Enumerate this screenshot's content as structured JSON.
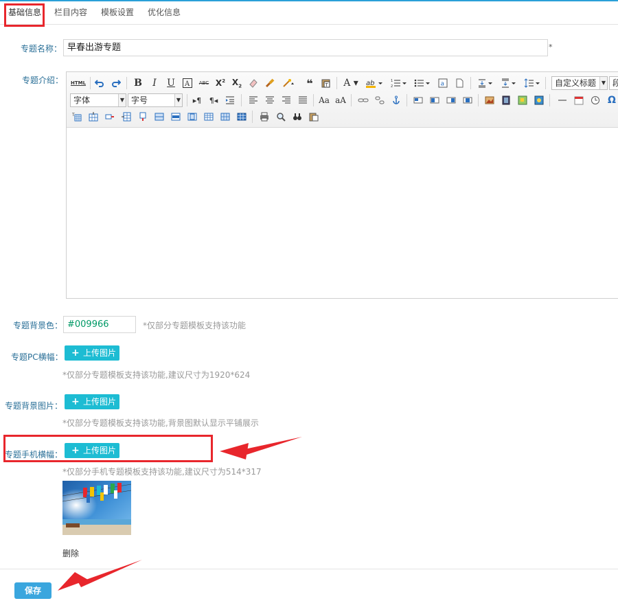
{
  "tabs": [
    {
      "label": "基础信息",
      "active": true
    },
    {
      "label": "栏目内容"
    },
    {
      "label": "模板设置"
    },
    {
      "label": "优化信息"
    }
  ],
  "form": {
    "name_label": "专题名称：",
    "name_value": "早春出游专题",
    "name_required": "*",
    "intro_label": "专题介绍：",
    "editor": {
      "font_select": "字体",
      "size_select": "字号",
      "heading_select": "自定义标题",
      "html_btn": "HTML",
      "bold": "B",
      "italic": "I",
      "underline": "U",
      "strike": "ABC"
    },
    "bgcolor_label": "专题背景色：",
    "bgcolor_value": "#009966",
    "bgcolor_hint": "*仅部分专题模板支持该功能",
    "pc_banner_label": "专题PC横幅：",
    "pc_banner_hint": "*仅部分专题模板支持该功能,建议尺寸为1920*624",
    "bg_image_label": "专题背景图片：",
    "bg_image_hint": "*仅部分专题模板支持该功能,背景图默认显示平铺展示",
    "mobile_banner_label": "专题手机横幅：",
    "mobile_banner_hint": "*仅部分手机专题模板支持该功能,建议尺寸为514*317",
    "upload_label": "上传图片",
    "delete_label": "删除",
    "save_label": "保存"
  },
  "colors": {
    "label_blue": "#2a6f97",
    "upload_teal": "#1dbcd3",
    "annotation_red": "#e8262c",
    "save_blue": "#3aa6de",
    "bgcolor_text": "#009966"
  }
}
